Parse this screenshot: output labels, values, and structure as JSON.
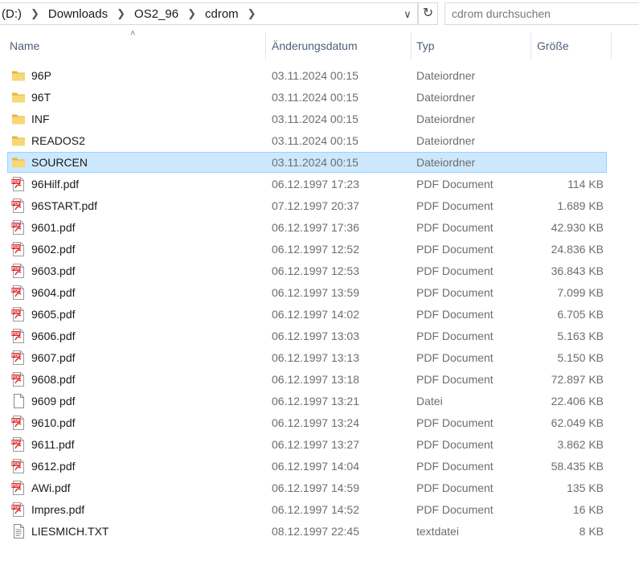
{
  "address_bar": {
    "crumbs": [
      "(D:)",
      "Downloads",
      "OS2_96",
      "cdrom"
    ]
  },
  "search": {
    "placeholder": "cdrom durchsuchen"
  },
  "columns": {
    "name": "Name",
    "date": "Änderungsdatum",
    "type": "Typ",
    "size": "Größe"
  },
  "sort": {
    "column": "name",
    "direction": "ascending"
  },
  "colors": {
    "selection_bg": "#cce8ff",
    "selection_border": "#99d1ff",
    "folder": "#f4c94a",
    "pdf_red": "#d9252a"
  },
  "files": [
    {
      "name": "96P",
      "date": "03.11.2024 00:15",
      "type": "Dateiordner",
      "size": "",
      "icon": "folder-icon"
    },
    {
      "name": "96T",
      "date": "03.11.2024 00:15",
      "type": "Dateiordner",
      "size": "",
      "icon": "folder-icon"
    },
    {
      "name": "INF",
      "date": "03.11.2024 00:15",
      "type": "Dateiordner",
      "size": "",
      "icon": "folder-icon"
    },
    {
      "name": "READOS2",
      "date": "03.11.2024 00:15",
      "type": "Dateiordner",
      "size": "",
      "icon": "folder-icon"
    },
    {
      "name": "SOURCEN",
      "date": "03.11.2024 00:15",
      "type": "Dateiordner",
      "size": "",
      "icon": "folder-icon",
      "selected": true
    },
    {
      "name": "96Hilf.pdf",
      "date": "06.12.1997 17:23",
      "type": "PDF Document",
      "size": "114 KB",
      "icon": "pdf-icon"
    },
    {
      "name": "96START.pdf",
      "date": "07.12.1997 20:37",
      "type": "PDF Document",
      "size": "1.689 KB",
      "icon": "pdf-icon"
    },
    {
      "name": "9601.pdf",
      "date": "06.12.1997 17:36",
      "type": "PDF Document",
      "size": "42.930 KB",
      "icon": "pdf-icon"
    },
    {
      "name": "9602.pdf",
      "date": "06.12.1997 12:52",
      "type": "PDF Document",
      "size": "24.836 KB",
      "icon": "pdf-icon"
    },
    {
      "name": "9603.pdf",
      "date": "06.12.1997 12:53",
      "type": "PDF Document",
      "size": "36.843 KB",
      "icon": "pdf-icon"
    },
    {
      "name": "9604.pdf",
      "date": "06.12.1997 13:59",
      "type": "PDF Document",
      "size": "7.099 KB",
      "icon": "pdf-icon"
    },
    {
      "name": "9605.pdf",
      "date": "06.12.1997 14:02",
      "type": "PDF Document",
      "size": "6.705 KB",
      "icon": "pdf-icon"
    },
    {
      "name": "9606.pdf",
      "date": "06.12.1997 13:03",
      "type": "PDF Document",
      "size": "5.163 KB",
      "icon": "pdf-icon"
    },
    {
      "name": "9607.pdf",
      "date": "06.12.1997 13:13",
      "type": "PDF Document",
      "size": "5.150 KB",
      "icon": "pdf-icon"
    },
    {
      "name": "9608.pdf",
      "date": "06.12.1997 13:18",
      "type": "PDF Document",
      "size": "72.897 KB",
      "icon": "pdf-icon"
    },
    {
      "name": "9609 pdf",
      "date": "06.12.1997 13:21",
      "type": "Datei",
      "size": "22.406 KB",
      "icon": "file-icon"
    },
    {
      "name": "9610.pdf",
      "date": "06.12.1997 13:24",
      "type": "PDF Document",
      "size": "62.049 KB",
      "icon": "pdf-icon"
    },
    {
      "name": "9611.pdf",
      "date": "06.12.1997 13:27",
      "type": "PDF Document",
      "size": "3.862 KB",
      "icon": "pdf-icon"
    },
    {
      "name": "9612.pdf",
      "date": "06.12.1997 14:04",
      "type": "PDF Document",
      "size": "58.435 KB",
      "icon": "pdf-icon"
    },
    {
      "name": "AWi.pdf",
      "date": "06.12.1997 14:59",
      "type": "PDF Document",
      "size": "135 KB",
      "icon": "pdf-icon"
    },
    {
      "name": "Impres.pdf",
      "date": "06.12.1997 14:52",
      "type": "PDF Document",
      "size": "16 KB",
      "icon": "pdf-icon"
    },
    {
      "name": "LIESMICH.TXT",
      "date": "08.12.1997 22:45",
      "type": "textdatei",
      "size": "8 KB",
      "icon": "text-file-icon"
    }
  ]
}
